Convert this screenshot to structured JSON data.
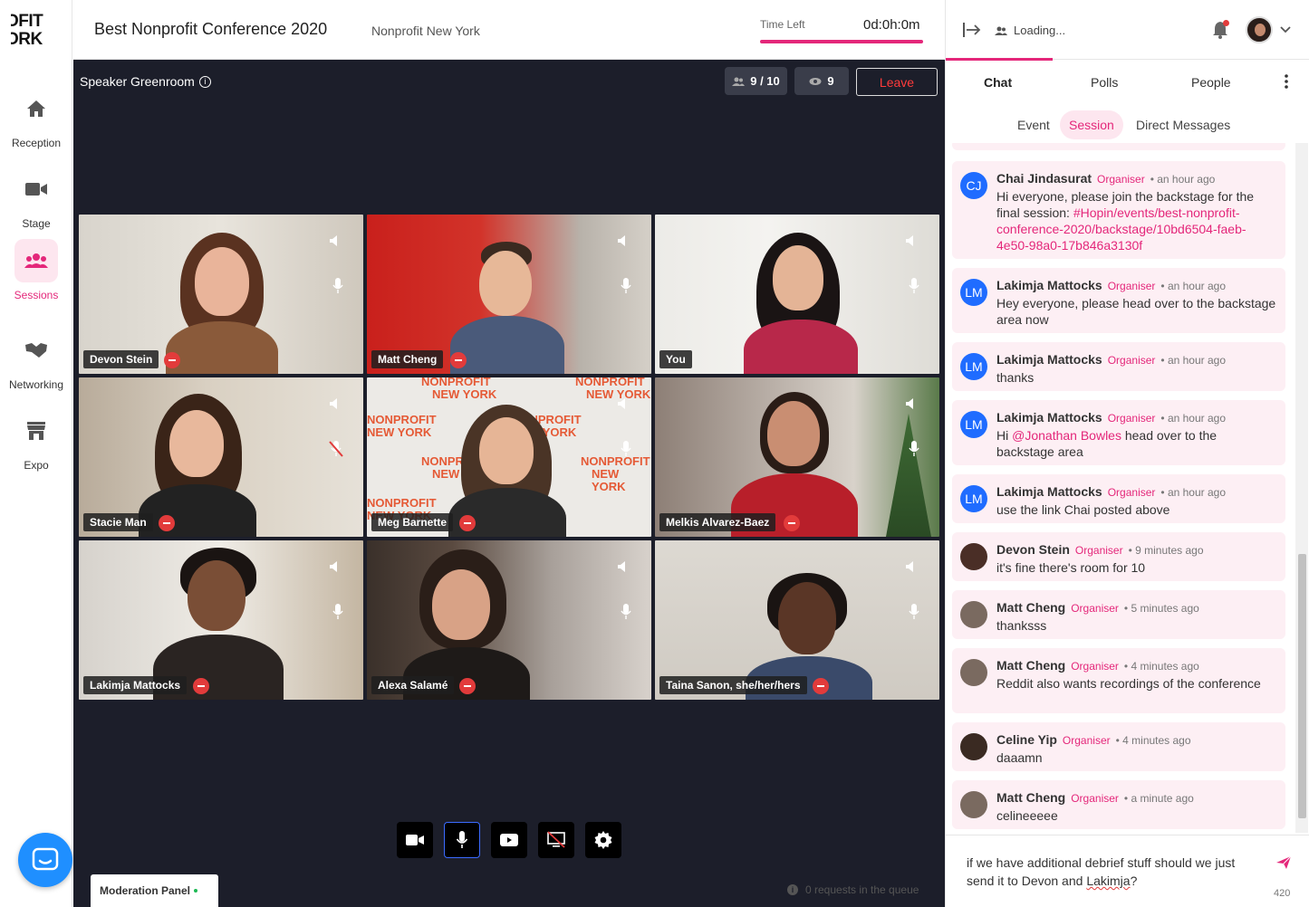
{
  "logo": {
    "line1": "OFIT",
    "line2": "ORK"
  },
  "nav": [
    {
      "label": "Reception",
      "icon": "home-icon",
      "active": false
    },
    {
      "label": "Stage",
      "icon": "video-camera-icon",
      "active": false
    },
    {
      "label": "Sessions",
      "icon": "people-group-icon",
      "active": true
    },
    {
      "label": "Networking",
      "icon": "handshake-icon",
      "active": false
    },
    {
      "label": "Expo",
      "icon": "storefront-icon",
      "active": false
    }
  ],
  "header": {
    "title": "Best Nonprofit Conference 2020",
    "organizer": "Nonprofit New York",
    "time_left_label": "Time Left",
    "time_left_value": "0d:0h:0m"
  },
  "stage": {
    "room_title": "Speaker Greenroom",
    "speakers_count": "9 / 10",
    "viewers_count": "9",
    "leave_label": "Leave",
    "moderation_label": "Moderation Panel",
    "queue_text": "0 requests in the queue"
  },
  "participants": [
    {
      "name": "Devon Stein"
    },
    {
      "name": "Matt Cheng"
    },
    {
      "name": "You"
    },
    {
      "name": "Stacie Man"
    },
    {
      "name": "Meg Barnette"
    },
    {
      "name": "Melkis Alvarez-Baez"
    },
    {
      "name": "Lakimja Mattocks"
    },
    {
      "name": "Alexa Salamé"
    },
    {
      "name": "Taina Sanon, she/her/hers"
    }
  ],
  "backdrop_text": [
    "NONPROFIT",
    "NEW YORK"
  ],
  "right_panel": {
    "loading_text": "Loading...",
    "tabs": [
      "Chat",
      "Polls",
      "People"
    ],
    "subtabs": [
      "Event",
      "Session",
      "Direct Messages"
    ]
  },
  "messages": [
    {
      "initials": "CJ",
      "name": "Chai Jindasurat",
      "role": "Organiser",
      "time": "• an hour ago",
      "text_prefix": "Hi everyone, please join the backstage for the final session: ",
      "link": "#Hopin/events/best-nonprofit-conference-2020/backstage/10bd6504-faeb-4e50-98a0-17b846a3130f",
      "text_suffix": ""
    },
    {
      "initials": "LM",
      "name": "Lakimja Mattocks",
      "role": "Organiser",
      "time": "• an hour ago",
      "text_prefix": "Hey everyone, please head over to the backstage area now",
      "link": "",
      "text_suffix": ""
    },
    {
      "initials": "LM",
      "name": "Lakimja Mattocks",
      "role": "Organiser",
      "time": "• an hour ago",
      "text_prefix": "thanks",
      "link": "",
      "text_suffix": ""
    },
    {
      "initials": "LM",
      "name": "Lakimja Mattocks",
      "role": "Organiser",
      "time": "• an hour ago",
      "text_prefix": "Hi ",
      "link": "@Jonathan Bowles",
      "text_suffix": " head over to the backstage area"
    },
    {
      "initials": "LM",
      "name": "Lakimja Mattocks",
      "role": "Organiser",
      "time": "• an hour ago",
      "text_prefix": "use the link Chai posted above",
      "link": "",
      "text_suffix": ""
    },
    {
      "initials": "",
      "name": "Devon Stein",
      "role": "Organiser",
      "time": "• 9 minutes ago",
      "text_prefix": "it's fine there's room for 10",
      "link": "",
      "text_suffix": ""
    },
    {
      "initials": "",
      "name": "Matt Cheng",
      "role": "Organiser",
      "time": "• 5 minutes ago",
      "text_prefix": "thanksss",
      "link": "",
      "text_suffix": ""
    },
    {
      "initials": "",
      "name": "Matt Cheng",
      "role": "Organiser",
      "time": "• 4 minutes ago",
      "text_prefix": "Reddit also wants recordings of the conference",
      "link": "",
      "text_suffix": ""
    },
    {
      "initials": "",
      "name": "Celine Yip",
      "role": "Organiser",
      "time": "• 4 minutes ago",
      "text_prefix": "daaamn",
      "link": "",
      "text_suffix": ""
    },
    {
      "initials": "",
      "name": "Matt Cheng",
      "role": "Organiser",
      "time": "• a minute ago",
      "text_prefix": "celineeeee",
      "link": "",
      "text_suffix": ""
    }
  ],
  "composer": {
    "text_before": "if we have additional debrief stuff should we just send it to Devon and ",
    "text_flagged": "Lakimja",
    "text_after": "?",
    "char_count": "420"
  },
  "colors": {
    "accent": "#e4277a",
    "stage_bg": "#1c1e2a",
    "chat_bubble": "#fdeff4",
    "avatar_blue": "#1f6cff",
    "kick_red": "#e23b3b"
  }
}
